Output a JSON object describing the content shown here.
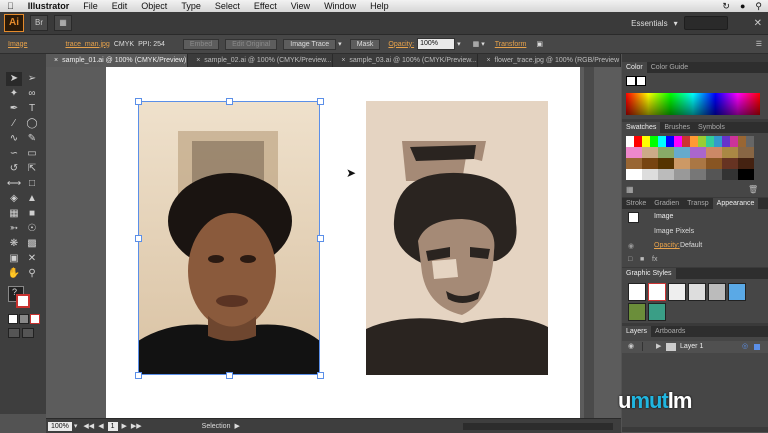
{
  "menubar": {
    "apple_icon": "apple-icon",
    "app_name": "Illustrator",
    "items": [
      "File",
      "Edit",
      "Object",
      "Type",
      "Select",
      "Effect",
      "View",
      "Window",
      "Help"
    ],
    "right_icons": [
      "sync-icon",
      "wifi-icon",
      "search-icon"
    ]
  },
  "appbar": {
    "logo": "Ai",
    "workspace": "Essentials",
    "window_buttons": [
      "close-icon"
    ]
  },
  "control": {
    "object_type": "Image",
    "file_link": "trace_man.jpg",
    "color_mode": "CMYK",
    "ppi_label": "PPI: 254",
    "embed": "Embed",
    "edit_original": "Edit Original",
    "image_trace": "Image Trace",
    "mask": "Mask",
    "opacity_label": "Opacity:",
    "opacity_value": "100%",
    "transform": "Transform"
  },
  "tabs": [
    {
      "label": "sample_01.ai @ 100% (CMYK/Preview)",
      "active": true
    },
    {
      "label": "sample_02.ai @ 100% (CMYK/Preview...",
      "active": false
    },
    {
      "label": "sample_03.ai @ 100% (CMYK/Preview...",
      "active": false
    },
    {
      "label": "flower_trace.jpg @ 100% (RGB/Preview",
      "active": false
    }
  ],
  "status": {
    "zoom": "100%",
    "page": "1",
    "tool": "Selection"
  },
  "panels": {
    "color_tabs": [
      "Color",
      "Color Guide"
    ],
    "swatch_tabs": [
      "Swatches",
      "Brushes",
      "Symbols"
    ],
    "appearance_tabs": [
      "Stroke",
      "Gradien",
      "Transp",
      "Appearance"
    ],
    "appearance_rows": {
      "header": "Image",
      "row1": "Image Pixels",
      "opacity_label": "Opacity:",
      "opacity_value": "Default"
    },
    "graphic_styles_tab": "Graphic Styles",
    "layers_tabs": [
      "Layers",
      "Artboards"
    ],
    "layer_name": "Layer 1"
  },
  "watermark": {
    "left": "u",
    "mid": "mut",
    "right": "lm"
  },
  "colors": {
    "accent": "#e8a24a",
    "selection": "#5b8fe8",
    "poster_light": "#e5d4c2",
    "poster_mid": "#a58a76",
    "poster_dark": "#2a2420"
  }
}
